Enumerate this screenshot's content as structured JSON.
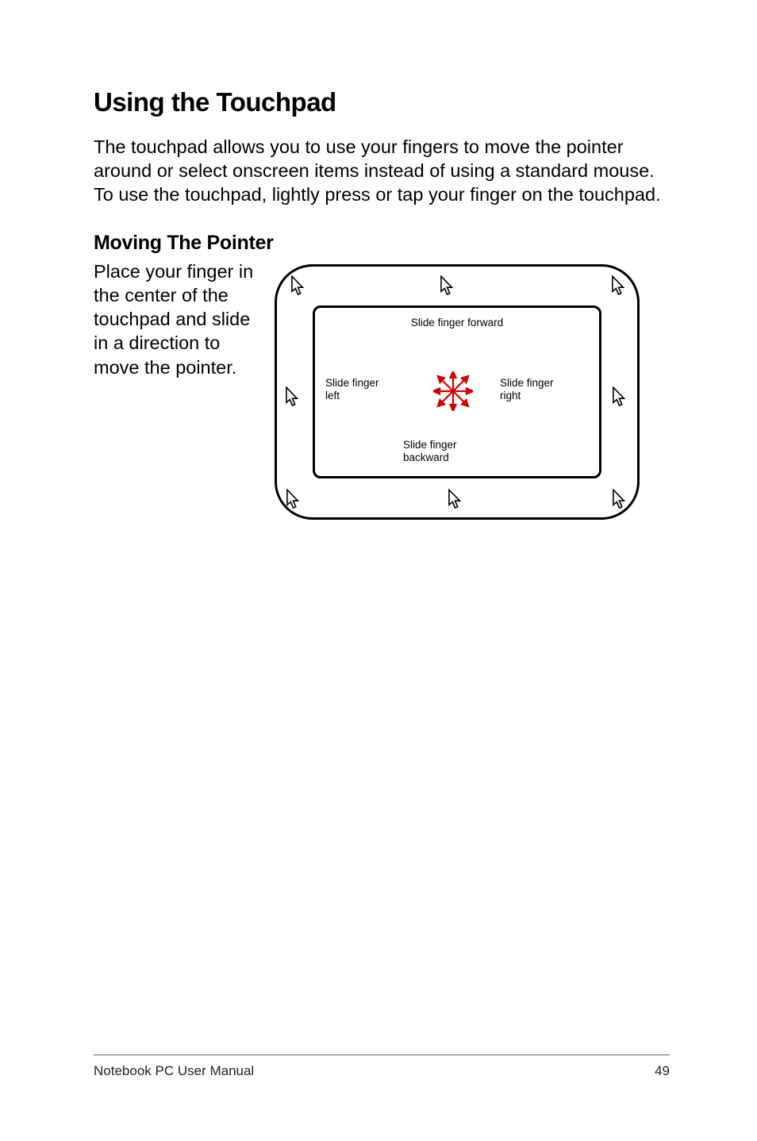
{
  "title": "Using the Touchpad",
  "intro": "The touchpad allows you to use your fingers to move the pointer around or select onscreen items instead of using a standard mouse. To use the touchpad, lightly press or tap your finger on the touchpad.",
  "section": {
    "heading": "Moving The Pointer",
    "body": "Place your finger in the center of the touchpad and slide in a direction to move the pointer."
  },
  "diagram": {
    "label_top": "Slide finger forward",
    "label_left": "Slide finger left",
    "label_right": "Slide finger right",
    "label_bottom": "Slide finger backward"
  },
  "footer": {
    "manual": "Notebook PC User Manual",
    "page": "49"
  }
}
